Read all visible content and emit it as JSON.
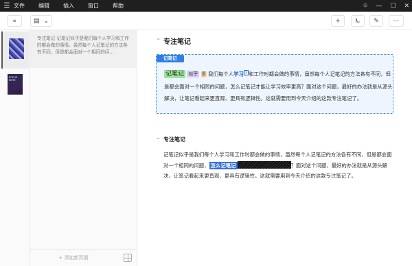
{
  "menubar": {
    "items": [
      "文件",
      "编辑",
      "插入",
      "窗口",
      "帮助"
    ],
    "window_controls": [
      "⯐",
      "—",
      "☐",
      "✕"
    ]
  },
  "toolbar": {
    "collapse_icon": "«",
    "view_icon": "▤",
    "dropdown_icon": "⌄",
    "add_icon": "+",
    "mark_icon": "ᗃ",
    "magic_icon": "✎",
    "more_icon": "⋯"
  },
  "thumbnails": [
    {
      "name": "pattern-thumbnail"
    },
    {
      "name": "cover-thumbnail",
      "text": "FOCUS NOTE"
    }
  ],
  "page_list": {
    "card_text": "专注笔记 记笔记似乎是我们每个人学习和工作时都会做的事情，虽然每个人记笔记的方法各有不同，但是都会面对一个相同的问...",
    "add_page": "+ 添加新页面"
  },
  "editor": {
    "block1": {
      "title": "专注笔记",
      "tag": "记笔记",
      "hl_word1": "记笔记",
      "hl_word2": "似乎",
      "hl_word3": "是",
      "text1": "我们每个人",
      "bold": "学习",
      "ref": "1",
      "text2": "和工作时都会做的事情，虽然每个人记笔记的方法各有不同，但是都会面对一个相同的问题，怎么记笔记才能让学习效率更高？面对这个问题，最好的办法就是从源头解决，让笔记看起来更直观、更具有逻辑性。这就需要用到今天介绍的这款专注笔记了。"
    },
    "block2": {
      "title": "专注笔记",
      "text1": "记笔记似乎是我们每个人学习和工作时都会做的事情，虽然每个人记笔记的方法各有不同，但是都会面对一个相同的问题，",
      "highlight": "怎么记笔记",
      "text2": "？面对这个问题，最好的办法就是从源头解决，让笔记看起来更直观、更具有逻辑性。这就需要用到今天介绍的这款专注笔记了。"
    }
  }
}
